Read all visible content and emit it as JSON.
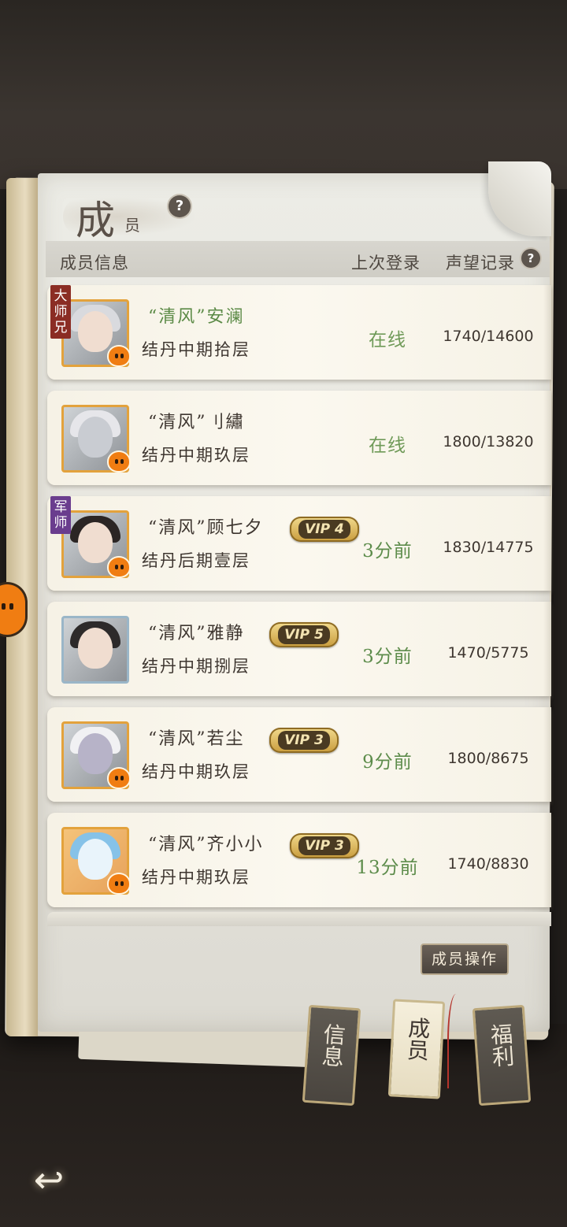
{
  "panel": {
    "title_big": "成",
    "title_small": "员",
    "help_icon": "question-circle-icon"
  },
  "header": {
    "member_info": "成员信息",
    "last_login": "上次登录",
    "reputation": "声望记录"
  },
  "members": [
    {
      "role": "大师兄",
      "name": "“清风”安澜",
      "rank": "结丹中期拾层",
      "vip": "",
      "status": "在线",
      "reputation": "1740/14600"
    },
    {
      "role": "",
      "name": "“清风”刂繡",
      "rank": "结丹中期玖层",
      "vip": "",
      "status": "在线",
      "reputation": "1800/13820"
    },
    {
      "role": "军师",
      "name": "“清风”顾七夕",
      "rank": "结丹后期壹层",
      "vip": "VIP 4",
      "status": "3分前",
      "reputation": "1830/14775"
    },
    {
      "role": "",
      "name": "“清风”雅静",
      "rank": "结丹中期捌层",
      "vip": "VIP 5",
      "status": "3分前",
      "reputation": "1470/5775"
    },
    {
      "role": "",
      "name": "“清风”若尘",
      "rank": "结丹中期玖层",
      "vip": "VIP 3",
      "status": "9分前",
      "reputation": "1800/8675"
    },
    {
      "role": "",
      "name": "“清风”齐小小",
      "rank": "结丹中期玖层",
      "vip": "VIP 3",
      "status": "13分前",
      "reputation": "1740/8830"
    }
  ],
  "actions": {
    "member_ops": "成员操作"
  },
  "tabs": [
    {
      "label": "信息",
      "active": false
    },
    {
      "label": "成员",
      "active": true
    },
    {
      "label": "福利",
      "active": false
    }
  ],
  "icons": {
    "back": "back-arrow-icon",
    "pet": "orange-pet-icon"
  },
  "colors": {
    "accent_gold": "#e3a23c",
    "online_green": "#6f9a58",
    "role_red": "#8b2d24",
    "role_purple": "#6a3d8e"
  }
}
